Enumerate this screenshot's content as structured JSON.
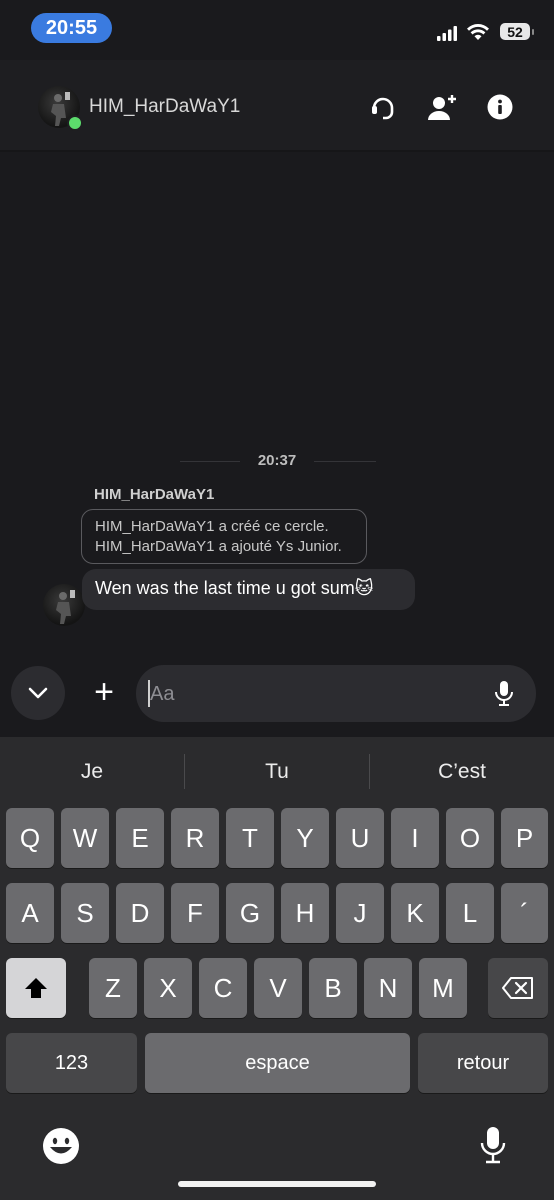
{
  "status_bar": {
    "time": "20:55",
    "battery": "52"
  },
  "header": {
    "username": "HIM_HarDaWaY1",
    "icons": [
      "headset-icon",
      "add-person-icon",
      "info-icon"
    ]
  },
  "chat": {
    "timestamp": "20:37",
    "sender": "HIM_HarDaWaY1",
    "system_lines": [
      "HIM_HarDaWaY1 a créé ce cercle.",
      "HIM_HarDaWaY1 a ajouté Ys Junior."
    ],
    "message": "Wen was the last time u got sum🐱"
  },
  "composer": {
    "placeholder": "Aa",
    "plus_label": "+"
  },
  "keyboard": {
    "suggestions": [
      "Je",
      "Tu",
      "C’est"
    ],
    "row1": [
      "Q",
      "W",
      "E",
      "R",
      "T",
      "Y",
      "U",
      "I",
      "O",
      "P"
    ],
    "row2": [
      "A",
      "S",
      "D",
      "F",
      "G",
      "H",
      "J",
      "K",
      "L",
      "´"
    ],
    "row3": [
      "Z",
      "X",
      "C",
      "V",
      "B",
      "N",
      "M"
    ],
    "numbers_key": "123",
    "space_key": "espace",
    "return_key": "retour"
  },
  "colors": {
    "background": "#1a1a1d",
    "accent_time": "#3a7be0",
    "online": "#5cdb6c",
    "bubble": "#2c2c30",
    "key": "#6b6b6e"
  }
}
